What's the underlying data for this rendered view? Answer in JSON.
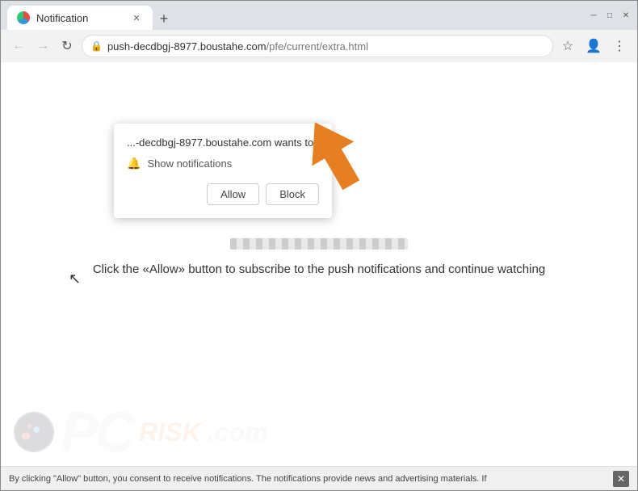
{
  "browser": {
    "title": "Notification",
    "url_display": "push-decdbgj-8977.boustahe.com",
    "url_path": "/pfe/current/extra.html",
    "tab_label": "Notification"
  },
  "notification_popup": {
    "header_text": "...-decdbgj-8977.boustahe.com wants to",
    "bell_label": "Show notifications",
    "allow_btn": "Allow",
    "block_btn": "Block"
  },
  "page": {
    "instruction_text": "Click the «Allow» button to subscribe to the push notifications and continue watching"
  },
  "bottom_bar": {
    "text": "By clicking \"Allow\" button, you consent to receive notifications. The notifications provide news and advertising materials. If"
  },
  "icons": {
    "back": "←",
    "forward": "→",
    "reload": "↻",
    "star": "☆",
    "user": "👤",
    "menu": "⋮",
    "lock": "🔒",
    "bell": "🔔",
    "close": "✕",
    "minimize": "─",
    "maximize": "□",
    "new_tab": "+"
  }
}
